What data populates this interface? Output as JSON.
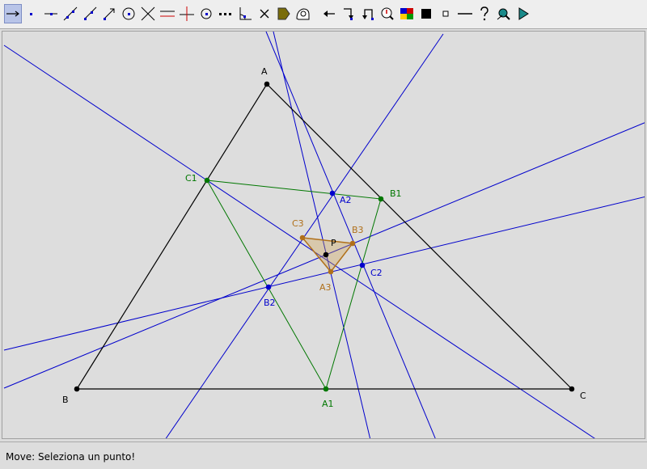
{
  "toolbar": {
    "tools": [
      {
        "id": "move",
        "icon": "move-arrow-icon",
        "active": true
      },
      {
        "id": "point",
        "icon": "point-icon"
      },
      {
        "id": "segment",
        "icon": "segment-icon"
      },
      {
        "id": "line",
        "icon": "line-icon"
      },
      {
        "id": "ray",
        "icon": "ray-icon"
      },
      {
        "id": "vector",
        "icon": "vector-icon"
      },
      {
        "id": "circle",
        "icon": "circle-icon"
      },
      {
        "id": "intersect",
        "icon": "intersect-icon"
      },
      {
        "id": "parallel",
        "icon": "parallel-line-icon"
      },
      {
        "id": "perpendicular",
        "icon": "perpendicular-line-icon"
      },
      {
        "id": "midpoint",
        "icon": "midpoint-icon"
      },
      {
        "id": "locus",
        "icon": "locus-dots-icon"
      },
      {
        "id": "angle",
        "icon": "angle-icon"
      },
      {
        "id": "delete",
        "icon": "delete-x-icon"
      },
      {
        "id": "polygon",
        "icon": "polygon-icon"
      },
      {
        "id": "zoom-in",
        "icon": "zoom-in-icon"
      },
      {
        "id": "translate",
        "icon": "translate-arrow-icon"
      },
      {
        "id": "rotate",
        "icon": "rotate-arrow-icon"
      },
      {
        "id": "reflect",
        "icon": "reflect-arrow-icon"
      },
      {
        "id": "text",
        "icon": "text-label-icon"
      },
      {
        "id": "color",
        "icon": "color-palette-icon"
      },
      {
        "id": "fill-style",
        "icon": "fill-square-icon"
      },
      {
        "id": "point-style",
        "icon": "point-style-icon"
      },
      {
        "id": "line-style",
        "icon": "line-style-icon"
      },
      {
        "id": "help",
        "icon": "help-icon"
      },
      {
        "id": "move-view",
        "icon": "move-view-icon"
      },
      {
        "id": "animate",
        "icon": "play-icon"
      }
    ]
  },
  "colors": {
    "triangle": "#000000",
    "cevians": "#0000cc",
    "green": "#007700",
    "orange": "#b0701a",
    "orange_fill": "rgba(205,160,80,0.35)",
    "canvas_bg": "#dddddd"
  },
  "points": {
    "A": {
      "label": "A",
      "color": "#000000"
    },
    "B": {
      "label": "B",
      "color": "#000000"
    },
    "C": {
      "label": "C",
      "color": "#000000"
    },
    "P": {
      "label": "P",
      "color": "#000000"
    },
    "A1": {
      "label": "A1",
      "color": "#007700"
    },
    "B1": {
      "label": "B1",
      "color": "#007700"
    },
    "C1": {
      "label": "C1",
      "color": "#007700"
    },
    "A2": {
      "label": "A2",
      "color": "#0000cc"
    },
    "B2": {
      "label": "B2",
      "color": "#0000cc"
    },
    "C2": {
      "label": "C2",
      "color": "#0000cc"
    },
    "A3": {
      "label": "A3",
      "color": "#b0701a"
    },
    "B3": {
      "label": "B3",
      "color": "#b0701a"
    },
    "C3": {
      "label": "C3",
      "color": "#b0701a"
    }
  },
  "status": {
    "text": "Move: Seleziona un punto!"
  }
}
